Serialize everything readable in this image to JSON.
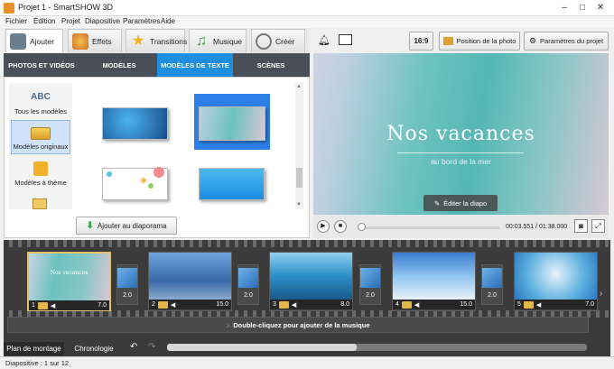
{
  "window": {
    "title": "Projet 1 - SmartSHOW 3D"
  },
  "menu": [
    "Fichier",
    "Édition",
    "Projet",
    "Diapositive",
    "Paramètres",
    "Aide"
  ],
  "ribbon_tabs": [
    {
      "label": "Ajouter",
      "icon": "add-folder-icon",
      "active": true
    },
    {
      "label": "Effets",
      "icon": "palette-icon"
    },
    {
      "label": "Transitions",
      "icon": "star-icon"
    },
    {
      "label": "Musique",
      "icon": "music-note-icon"
    },
    {
      "label": "Créer",
      "icon": "film-reel-icon"
    }
  ],
  "sub_tabs": [
    "PHOTOS ET VIDÉOS",
    "MODÈLES",
    "MODÈLES DE TEXTE",
    "SCÈNES"
  ],
  "sub_tab_active": "MODÈLES DE TEXTE",
  "categories": [
    {
      "label": "Tous les modèles",
      "icon": "abc-text-icon"
    },
    {
      "label": "Modèles originaux",
      "icon": "original-template-icon",
      "active": true
    },
    {
      "label": "Modèles à thème",
      "icon": "gift-icon"
    }
  ],
  "add_button": "Ajouter au diaporama",
  "toolbar": {
    "aspect": "16:9",
    "photo_position": "Position de la photo",
    "project_settings": "Paramètres du projet"
  },
  "preview": {
    "title": "Nos vacances",
    "subtitle": "au bord de la mer",
    "edit_button": "Éditer la diapo"
  },
  "player": {
    "timecode": "00:03.551 / 01:38.000",
    "progress": 0.02
  },
  "slides": [
    {
      "index": "1",
      "duration": "7.0",
      "title": "Nos vacances",
      "selected": true
    },
    {
      "index": "2",
      "duration": "15.0"
    },
    {
      "index": "3",
      "duration": "8.0"
    },
    {
      "index": "4",
      "duration": "15.0"
    },
    {
      "index": "5",
      "duration": "7.0"
    }
  ],
  "transitions": [
    "2.0",
    "2.0",
    "2.0",
    "2.0"
  ],
  "music_hint": "Double-cliquez pour ajouter de la musique",
  "bottom_tabs": [
    "Plan de montage",
    "Chronologie"
  ],
  "status": "Diapositive : 1 sur 12",
  "colors": {
    "accent": "#1e8fe0",
    "selected_slide": "#e4c26a",
    "timeline_bg": "#3b3b3b"
  }
}
